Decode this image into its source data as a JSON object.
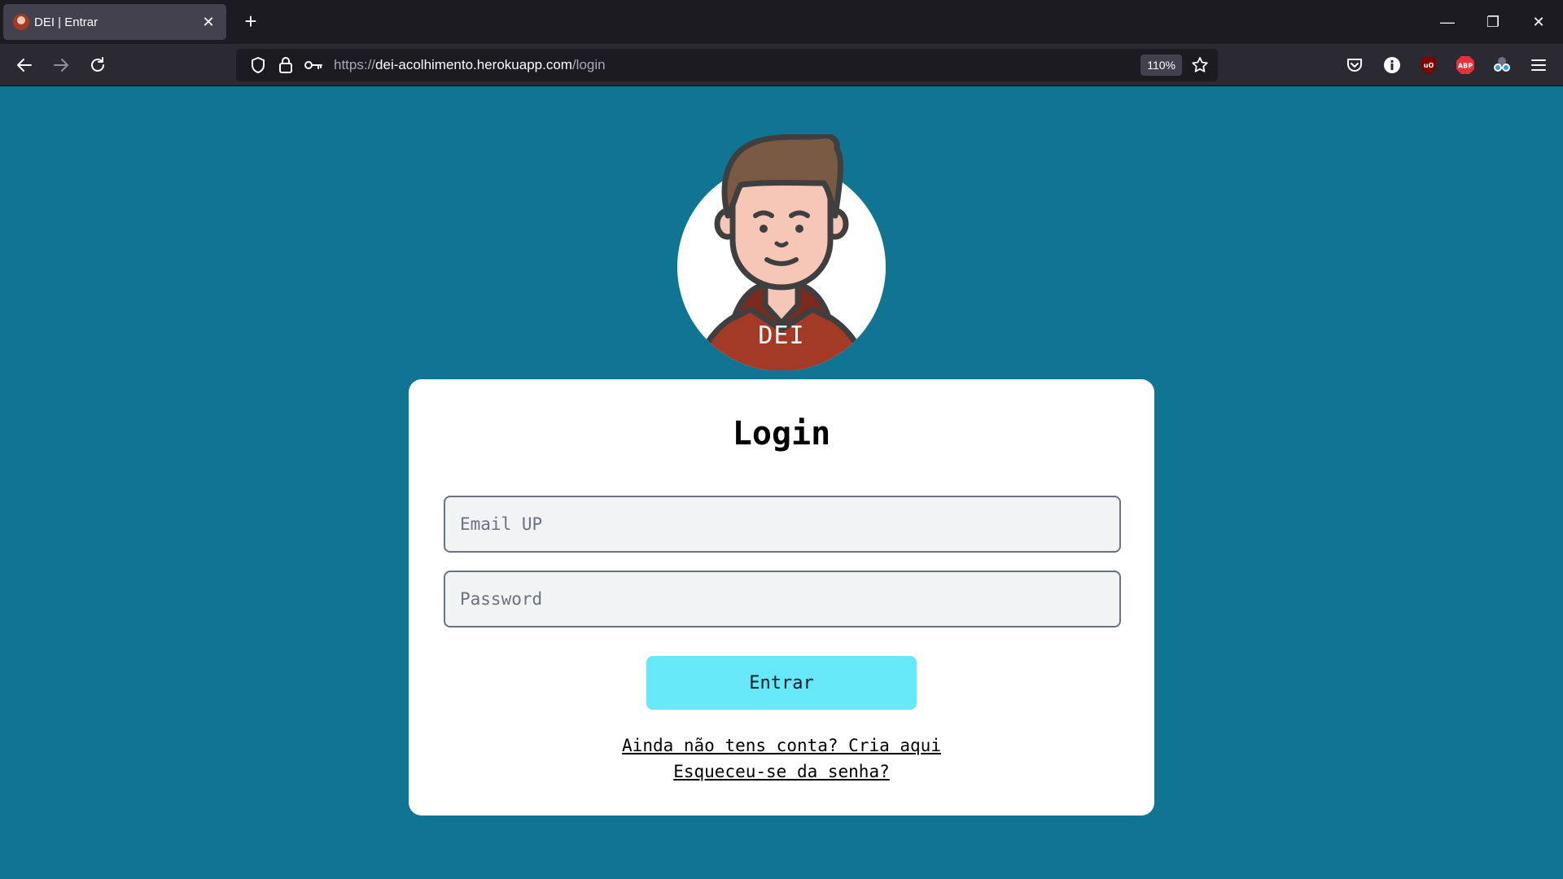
{
  "browser": {
    "tab": {
      "title": "DEI | Entrar",
      "close": "✕"
    },
    "new_tab": "+",
    "window_controls": {
      "minimize": "—",
      "restore": "❐",
      "close": "✕"
    },
    "url": {
      "scheme": "https://",
      "host": "dei-acolhimento.herokuapp.com",
      "path": "/login"
    },
    "zoom": "110%",
    "extensions": [
      "pocket-icon",
      "info-icon",
      "ublock-icon",
      "adblock-plus-icon",
      "glasses-icon"
    ],
    "abp_label": "ABP",
    "ublock_label": "uO"
  },
  "page": {
    "avatar_label": "DEI",
    "title": "Login",
    "email_placeholder": "Email UP",
    "password_placeholder": "Password",
    "submit_label": "Entrar",
    "register_link": "Ainda não tens conta? Cria aqui",
    "forgot_link": "Esqueceu-se da senha?"
  },
  "colors": {
    "background": "#0f7593",
    "button": "#67e8f9",
    "avatar_shirt": "#a33a26"
  }
}
